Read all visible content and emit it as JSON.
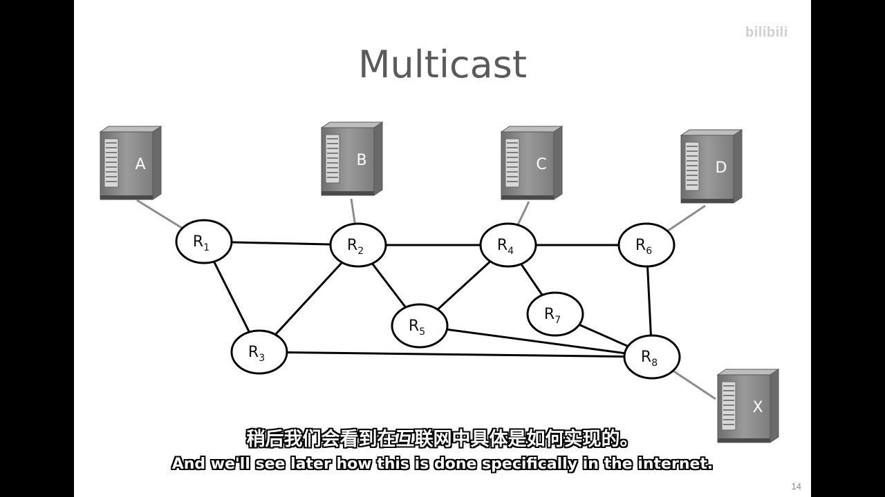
{
  "slide": {
    "title": "Multicast",
    "page_number": "14"
  },
  "watermark": "bilibili",
  "hosts": [
    {
      "id": "A",
      "label": "A"
    },
    {
      "id": "B",
      "label": "B"
    },
    {
      "id": "C",
      "label": "C"
    },
    {
      "id": "D",
      "label": "D"
    },
    {
      "id": "X",
      "label": "X"
    }
  ],
  "routers": [
    {
      "id": "R1",
      "letter": "R",
      "sub": "1"
    },
    {
      "id": "R2",
      "letter": "R",
      "sub": "2"
    },
    {
      "id": "R3",
      "letter": "R",
      "sub": "3"
    },
    {
      "id": "R4",
      "letter": "R",
      "sub": "4"
    },
    {
      "id": "R5",
      "letter": "R",
      "sub": "5"
    },
    {
      "id": "R6",
      "letter": "R",
      "sub": "6"
    },
    {
      "id": "R7",
      "letter": "R",
      "sub": "7"
    },
    {
      "id": "R8",
      "letter": "R",
      "sub": "8"
    }
  ],
  "router_links": [
    [
      "R1",
      "R2"
    ],
    [
      "R2",
      "R4"
    ],
    [
      "R4",
      "R6"
    ],
    [
      "R1",
      "R3"
    ],
    [
      "R2",
      "R3"
    ],
    [
      "R2",
      "R5"
    ],
    [
      "R4",
      "R5"
    ],
    [
      "R4",
      "R7"
    ],
    [
      "R6",
      "R8"
    ],
    [
      "R7",
      "R8"
    ],
    [
      "R5",
      "R8"
    ],
    [
      "R3",
      "R8"
    ]
  ],
  "host_links": [
    [
      "A",
      "R1"
    ],
    [
      "B",
      "R2"
    ],
    [
      "C",
      "R4"
    ],
    [
      "D",
      "R6"
    ],
    [
      "X",
      "R8"
    ]
  ],
  "subtitles": {
    "zh": "稍后我们会看到在互联网中具体是如何实现的。",
    "en": "And we'll see later how this is done specifically in the internet."
  },
  "colors": {
    "router_stroke": "#000000",
    "router_link": "#000000",
    "host_link": "#8c8c8c",
    "server_body": "#8a8a8a"
  }
}
